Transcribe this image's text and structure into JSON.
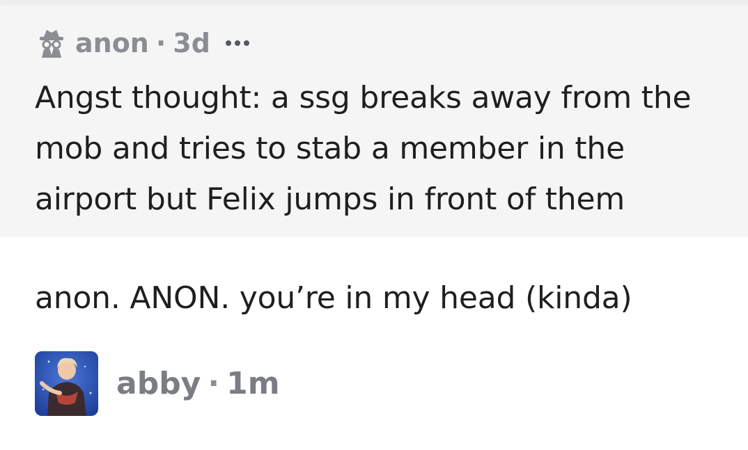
{
  "question": {
    "author": "anon",
    "separator": "·",
    "age": "3d",
    "icon": "incognito-icon",
    "more_icon": "more-icon",
    "text": "Angst thought: a ssg breaks away from the mob and tries to stab a member in the airport but Felix jumps in front of them"
  },
  "answer": {
    "text": "anon. ANON. you’re in my head (kinda)"
  },
  "answerer": {
    "name": "abby",
    "separator": "·",
    "age": "1m",
    "avatar": "avatar-photo"
  },
  "colors": {
    "card_background": "#f5f5f5",
    "meta_text": "#8a8d91",
    "body_text": "#1f1f1f",
    "avatar_bg": "#2b55b8"
  }
}
